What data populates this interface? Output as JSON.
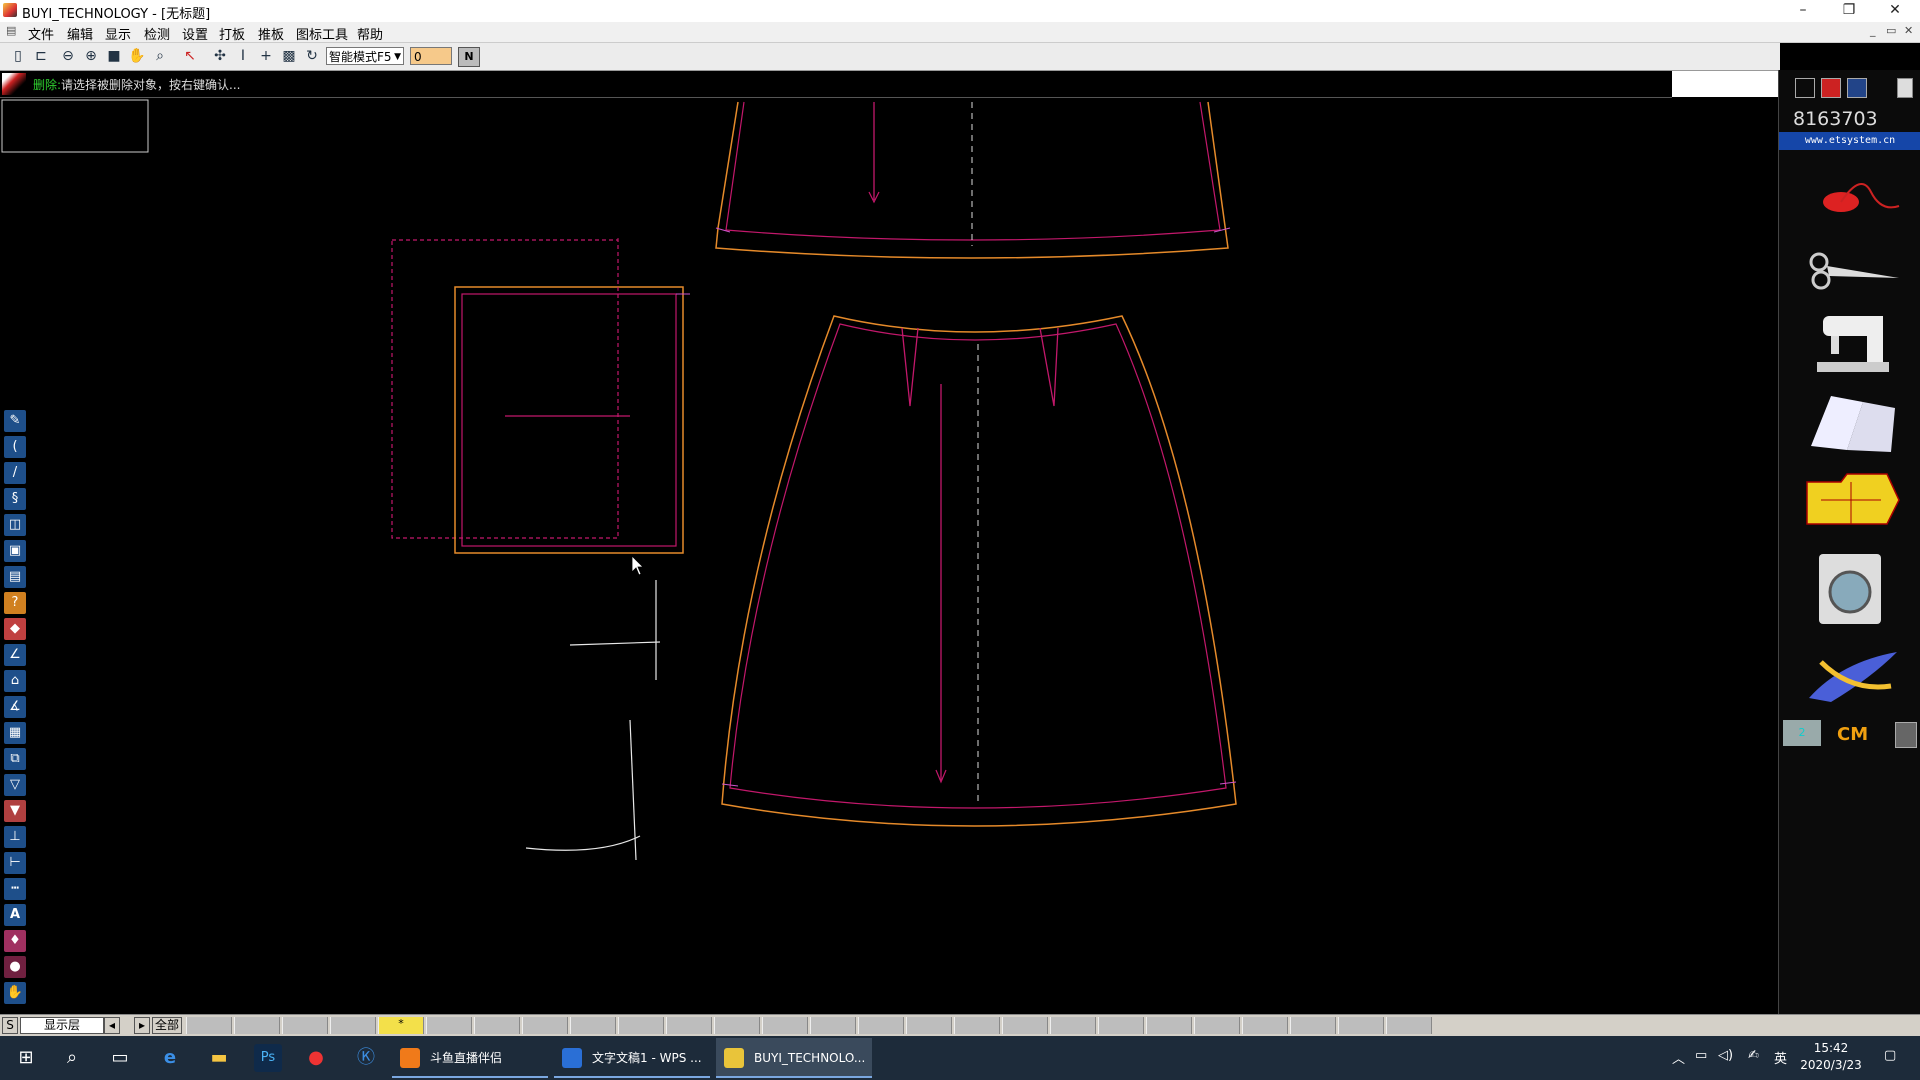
{
  "window": {
    "title": "BUYI_TECHNOLOGY - [无标题]",
    "minimize": "–",
    "restore": "❐",
    "close": "✕",
    "mdi_controls": [
      "_",
      "▭",
      "✕"
    ]
  },
  "menu": [
    "文件",
    "编辑",
    "显示",
    "检测",
    "设置",
    "打板",
    "推板",
    "图标工具",
    "帮助"
  ],
  "toolbar": {
    "mode_select": "智能模式F5",
    "number_value": "0",
    "n_button": "N"
  },
  "prompt": {
    "label": "删除:",
    "text": "请选择被删除对象，按右键确认..."
  },
  "right_panel": {
    "phone": "8163703",
    "website": "www.etsystem.cn",
    "layer_number": "2",
    "unit": "CM",
    "items": [
      "thread-spool-icon",
      "scissors-icon",
      "sewing-machine-icon",
      "paper-stack-icon",
      "folder-pattern-icon",
      "washing-machine-icon",
      "measuring-tape-icon"
    ]
  },
  "layer_bar": {
    "s_label": "S",
    "layer_label": "显示层",
    "all_label": "全部",
    "active_slot": "*"
  },
  "taskbar": {
    "apps": [
      {
        "label": "斗鱼直播伴侣",
        "color": "#f07a1a",
        "active": false
      },
      {
        "label": "文字文稿1 - WPS ...",
        "color": "#2a6fd6",
        "active": false
      },
      {
        "label": "BUYI_TECHNOLO...",
        "color": "#e9c43a",
        "active": true
      }
    ],
    "time": "15:42",
    "date": "2020/3/23",
    "ime": "英"
  }
}
